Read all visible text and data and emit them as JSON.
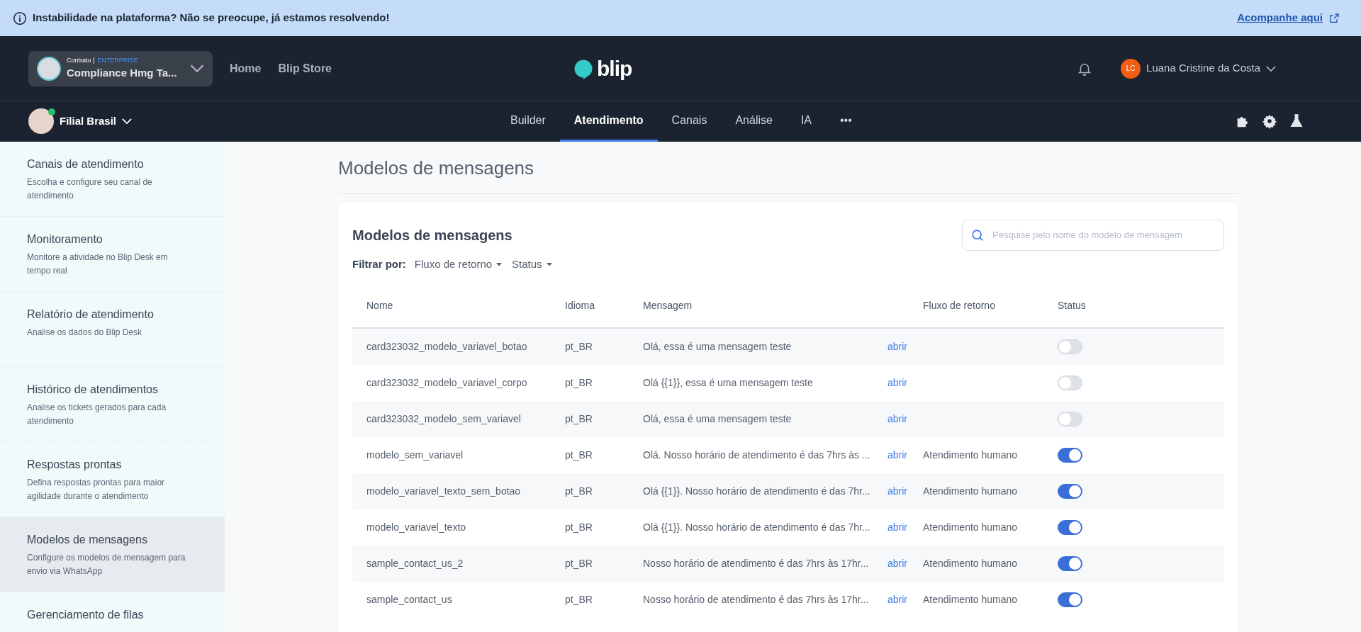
{
  "banner": {
    "message": "Instabilidade na plataforma? Não se preocupe, já estamos resolvendo!",
    "link": "Acompanhe aqui"
  },
  "topbar": {
    "contract_label": "Contrato |",
    "contract_plan": "ENTERPRISE",
    "contract_name": "Compliance Hmg Ta...",
    "links": [
      "Home",
      "Blip Store"
    ],
    "logo_text": "blip",
    "user_initials": "LC",
    "user_name": "Luana Cristine da Costa"
  },
  "subbar": {
    "bot_name": "Filial Brasil",
    "bot_online": true,
    "tabs": [
      {
        "label": "Builder",
        "selected": false
      },
      {
        "label": "Atendimento",
        "selected": true
      },
      {
        "label": "Canais",
        "selected": false
      },
      {
        "label": "Análise",
        "selected": false
      },
      {
        "label": "IA",
        "selected": false
      },
      {
        "label": "•••",
        "selected": false
      }
    ]
  },
  "sidebar": {
    "items": [
      {
        "title": "Canais de atendimento",
        "description": "Escolha e configure seu canal de atendimento",
        "selected": false
      },
      {
        "title": "Monitoramento",
        "description": "Monitore a atividade no Blip Desk em tempo real",
        "selected": false
      },
      {
        "title": "Relatório de atendimento",
        "description": "Analise os dados do Blip Desk",
        "selected": false
      },
      {
        "title": "Histórico de atendimentos",
        "description": "Analise os tickets gerados para cada atendimento",
        "selected": false
      },
      {
        "title": "Respostas prontas",
        "description": "Defina respostas prontas para maior agilidade durante o atendimento",
        "selected": false
      },
      {
        "title": "Modelos de mensagens",
        "description": "Configure os modelos de mensagem para envio via WhatsApp",
        "selected": true
      },
      {
        "title": "Gerenciamento de filas",
        "selected": false
      }
    ]
  },
  "page_title": "Modelos de mensagens",
  "card": {
    "title": "Modelos de mensagens",
    "search": {
      "placeholder": "Pesquise pelo nome do modelo de mensagem"
    },
    "filter_label": "Filtrar por:",
    "filters": [
      "Fluxo de retorno",
      "Status"
    ]
  },
  "table": {
    "columns": [
      "Nome",
      "Idioma",
      "Mensagem",
      "Fluxo de retorno",
      "Status"
    ],
    "rows": [
      {
        "name": "card323032_modelo_variavel_botao",
        "language": "pt_BR",
        "message": "Olá, essa é uma mensagem teste",
        "link": "abrir",
        "flow": "",
        "on": false
      },
      {
        "name": "card323032_modelo_variavel_corpo",
        "language": "pt_BR",
        "message": "Olá {{1}}, essa é uma mensagem teste",
        "link": "abrir",
        "flow": "",
        "on": false
      },
      {
        "name": "card323032_modelo_sem_variavel",
        "language": "pt_BR",
        "message": "Olá, essa é uma mensagem teste",
        "link": "abrir",
        "flow": "",
        "on": false
      },
      {
        "name": "modelo_sem_variavel",
        "language": "pt_BR",
        "message": "Olá. Nosso horário de atendimento é das 7hrs às ...",
        "link": "abrir",
        "flow": "Atendimento humano",
        "on": true
      },
      {
        "name": "modelo_variavel_texto_sem_botao",
        "language": "pt_BR",
        "message": "Olá {{1}}. Nosso horário de atendimento é das 7hr...",
        "link": "abrir",
        "flow": "Atendimento humano",
        "on": true
      },
      {
        "name": "modelo_variavel_texto",
        "language": "pt_BR",
        "message": "Olá {{1}}. Nosso horário de atendimento é das 7hr...",
        "link": "abrir",
        "flow": "Atendimento humano",
        "on": true
      },
      {
        "name": "sample_contact_us_2",
        "language": "pt_BR",
        "message": "Nosso horário de atendimento é das 7hrs às 17hr...",
        "link": "abrir",
        "flow": "Atendimento humano",
        "on": true
      },
      {
        "name": "sample_contact_us",
        "language": "pt_BR",
        "message": "Nosso horário de atendimento é das 7hrs às 17hr...",
        "link": "abrir",
        "flow": "Atendimento humano",
        "on": true
      }
    ]
  }
}
